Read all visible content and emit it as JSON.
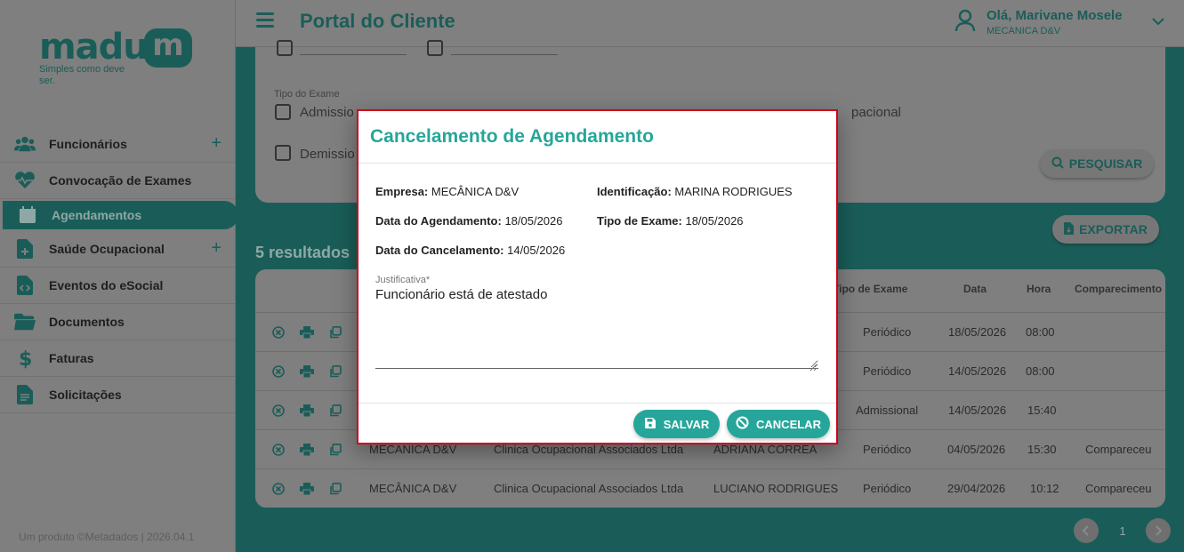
{
  "brand": {
    "logo_word": "madu",
    "logo_badge": "m",
    "tagline": "Simples como deve ser."
  },
  "sidebar": {
    "items": [
      {
        "label": "Funcionários",
        "icon": "users-icon",
        "has_plus": true
      },
      {
        "label": "Convocação de Exames",
        "icon": "heartbeat-icon",
        "has_plus": false
      },
      {
        "label": "Agendamentos",
        "icon": "calendar-icon",
        "has_plus": false,
        "active": true
      },
      {
        "label": "Saúde Ocupacional",
        "icon": "medical-file-icon",
        "has_plus": true
      },
      {
        "label": "Eventos do eSocial",
        "icon": "code-file-icon",
        "has_plus": false
      },
      {
        "label": "Documentos",
        "icon": "folder-icon",
        "has_plus": false
      },
      {
        "label": "Faturas",
        "icon": "dollar-icon",
        "has_plus": false
      },
      {
        "label": "Solicitações",
        "icon": "document-icon",
        "has_plus": false
      }
    ],
    "plus": "+",
    "footer": "Um produto ©Metadados | 2026.04.1"
  },
  "header": {
    "title": "Portal do Cliente",
    "user_greeting": "Olá, Marivane Mosele",
    "user_company": "MECANICA D&V"
  },
  "filters": {
    "tipo_label": "Tipo do Exame",
    "options": [
      "Admissio",
      "Demissio",
      "pacional"
    ],
    "search_button": "PESQUISAR"
  },
  "results": {
    "count": "5",
    "label": "resultados",
    "export_button": "EXPORTAR",
    "columns": [
      "Tipo de Exame",
      "Data",
      "Hora",
      "Comparecimento"
    ],
    "rows": [
      {
        "empresa": "",
        "clinica": "",
        "funcionario": "",
        "tipo": "Periódico",
        "data": "18/05/2026",
        "hora": "08:00",
        "comparecimento": ""
      },
      {
        "empresa": "",
        "clinica": "",
        "funcionario": "",
        "tipo": "Periódico",
        "data": "14/05/2026",
        "hora": "08:00",
        "comparecimento": ""
      },
      {
        "empresa": "",
        "clinica": "",
        "funcionario": "",
        "tipo": "Admissional",
        "data": "14/05/2026",
        "hora": "15:40",
        "comparecimento": ""
      },
      {
        "empresa": "MECANICA D&V",
        "clinica": "Clinica Ocupacional Associados Ltda",
        "funcionario": "ADRIANA CORREA",
        "tipo": "Periódico",
        "data": "04/05/2026",
        "hora": "15:30",
        "comparecimento": "Compareceu"
      },
      {
        "empresa": "MECÂNICA D&V",
        "clinica": "Clinica Ocupacional Associados Ltda",
        "funcionario": "LUCIANO RODRIGUES",
        "tipo": "Periódico",
        "data": "29/04/2026",
        "hora": "10:12",
        "comparecimento": "Compareceu"
      }
    ],
    "pagination": {
      "current": "1"
    }
  },
  "modal": {
    "title": "Cancelamento de Agendamento",
    "empresa_label": "Empresa:",
    "empresa_value": "MECÂNICA D&V",
    "identificacao_label": "Identificação:",
    "identificacao_value": "MARINA RODRIGUES",
    "data_agendamento_label": "Data do Agendamento:",
    "data_agendamento_value": "18/05/2026",
    "tipo_exame_label": "Tipo de Exame:",
    "tipo_exame_value": "18/05/2026",
    "data_cancelamento_label": "Data do Cancelamento:",
    "data_cancelamento_value": "14/05/2026",
    "justificativa_label": "Justificativa*",
    "justificativa_value": "Funcionário está de atestado",
    "save_button": "SALVAR",
    "cancel_button": "CANCELAR",
    "accent_color": "#26a69a",
    "highlight_border": "#d0021b"
  }
}
